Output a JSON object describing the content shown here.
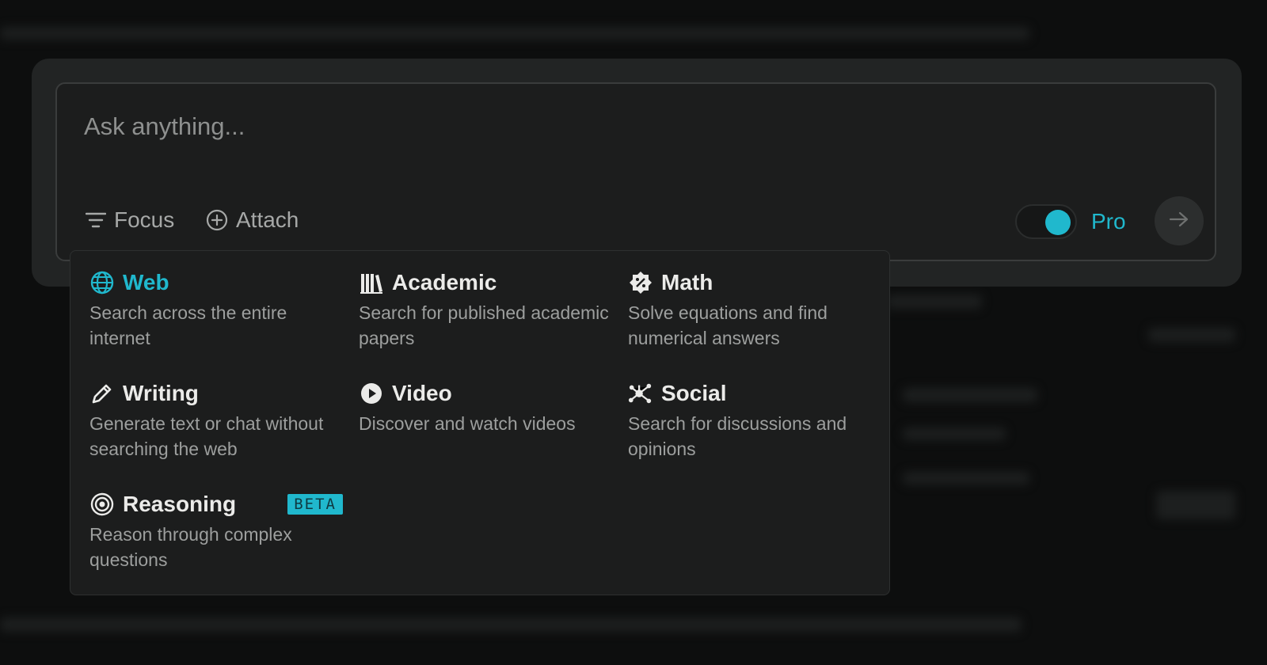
{
  "colors": {
    "accent": "#20b8cd",
    "background": "#0d0e0e",
    "panel": "#1c1d1d"
  },
  "input": {
    "placeholder": "Ask anything..."
  },
  "toolbar": {
    "focus_label": "Focus",
    "focus_icon": "filter-icon",
    "attach_label": "Attach",
    "attach_icon": "plus-circle-icon",
    "pro_label": "Pro",
    "pro_enabled": true,
    "submit_icon": "arrow-right-icon"
  },
  "focus_menu": {
    "options": [
      {
        "icon": "globe-icon",
        "title": "Web",
        "description": "Search across the entire internet",
        "selected": true
      },
      {
        "icon": "books-icon",
        "title": "Academic",
        "description": "Search for published academic papers"
      },
      {
        "icon": "math-icon",
        "title": "Math",
        "description": "Solve equations and find numerical answers"
      },
      {
        "icon": "pencil-icon",
        "title": "Writing",
        "description": "Generate text or chat without searching the web"
      },
      {
        "icon": "play-icon",
        "title": "Video",
        "description": "Discover and watch videos"
      },
      {
        "icon": "network-icon",
        "title": "Social",
        "description": "Search for discussions and opinions"
      },
      {
        "icon": "target-icon",
        "title": "Reasoning",
        "description": "Reason through complex questions",
        "badge": "BETA"
      }
    ]
  }
}
